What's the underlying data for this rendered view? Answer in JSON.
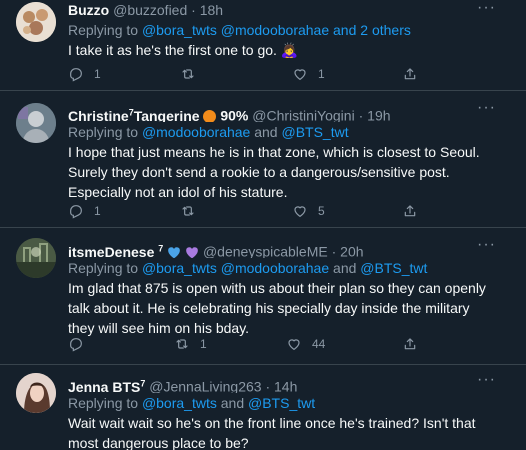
{
  "tweets": [
    {
      "name": "Buzzo",
      "handle": "@buzzofied",
      "time": "18h",
      "replying_prefix": "Replying to",
      "mentions": "@bora_twts @modooborahae and 2 others",
      "text": "I take it as he's the first one to go. 🙇‍♀️",
      "replies": "1",
      "retweets": "",
      "likes": "1"
    },
    {
      "name": "Christine",
      "name_sup": "7",
      "name_suffix": "Tangerine",
      "badge": "90%",
      "handle": "@ChristiniYogini",
      "time": "19h",
      "replying_prefix": "Replying to",
      "mention1": "@modooborahae",
      "conj": "and",
      "mention2": "@BTS_twt",
      "text": "I hope that just means he is in that zone, which is closest to Seoul. Surely they don't send a rookie to a dangerous/sensitive post. Especially not an idol of his stature.",
      "replies": "1",
      "retweets": "",
      "likes": "5"
    },
    {
      "name": "itsmeDenese",
      "name_sup": "7",
      "handle": "@deneyspicableME",
      "time": "20h",
      "replying_prefix": "Replying to",
      "mention1": "@bora_twts @modooborahae",
      "conj": "and",
      "mention2": "@BTS_twt",
      "text": "Im glad that 875 is open with us about their plan so they can openly talk about it. He is celebrating his specially day inside the military they will see him on his bday.",
      "replies": "",
      "retweets": "1",
      "likes": "44"
    },
    {
      "name": "Jenna BTS",
      "name_sup": "7",
      "handle": "@JennaLiving263",
      "time": "14h",
      "replying_prefix": "Replying to",
      "mention1": "@bora_twts",
      "conj": "and",
      "mention2": "@BTS_twt",
      "text": "Wait wait wait so he's on the front line once he's trained? Isn't that most dangerous place to be?"
    }
  ],
  "more_label": "···",
  "dot": "·",
  "colors": {
    "background": "#15202b",
    "accent": "#1d9bf0",
    "muted": "#8b98a5",
    "divider": "#38444d"
  },
  "icons": [
    "reply-icon",
    "retweet-icon",
    "like-icon",
    "share-icon",
    "more-icon"
  ]
}
